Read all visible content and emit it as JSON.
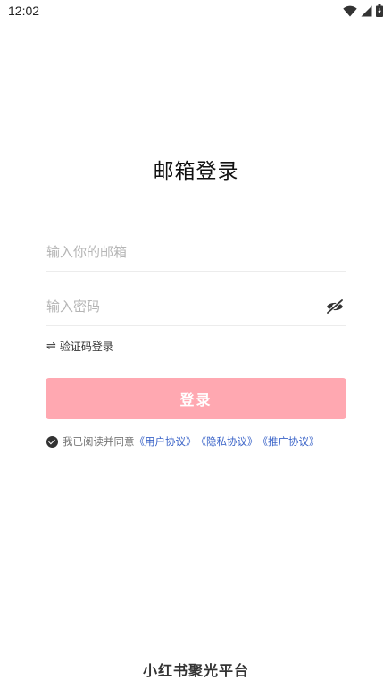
{
  "status_bar": {
    "time": "12:02",
    "icons": [
      "wifi-icon",
      "signal-icon",
      "battery-icon"
    ]
  },
  "page": {
    "title": "邮箱登录"
  },
  "form": {
    "email_placeholder": "输入你的邮箱",
    "password_placeholder": "输入密码",
    "switch_icon": "⇌",
    "switch_label": "验证码登录",
    "login_label": "登录"
  },
  "agreement": {
    "prefix": "我已阅读并同意",
    "user_agreement": "《用户协议》",
    "privacy_agreement": "《隐私协议》",
    "promotion_agreement": "《推广协议》"
  },
  "brand": {
    "name": "小红书聚光平台"
  },
  "colors": {
    "login_button": "#ffa8b1",
    "link": "#3b64c8",
    "brand_gradient_start": "#ff8a9a",
    "brand_gradient_end": "#f0354e"
  }
}
